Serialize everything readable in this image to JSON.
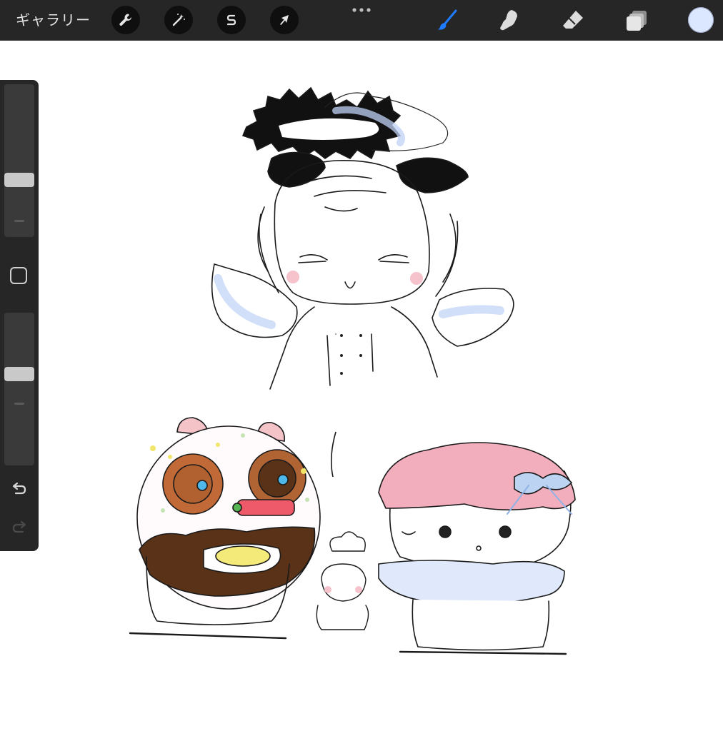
{
  "topbar": {
    "gallery_label": "ギャラリー",
    "actions": [
      {
        "name": "actions",
        "icon": "wrench-icon"
      },
      {
        "name": "adjustments",
        "icon": "magic-wand-icon"
      },
      {
        "name": "selection",
        "icon": "selection-s-icon"
      },
      {
        "name": "transform",
        "icon": "arrow-cursor-icon"
      }
    ],
    "more_icon": "ellipsis-icon",
    "tools": [
      {
        "name": "brush",
        "icon": "brush-icon",
        "active": true
      },
      {
        "name": "smudge",
        "icon": "smudge-finger-icon",
        "active": false
      },
      {
        "name": "eraser",
        "icon": "eraser-icon",
        "active": false
      },
      {
        "name": "layers",
        "icon": "layers-icon",
        "active": false
      }
    ],
    "current_color": "#dbe6ff"
  },
  "sidebar": {
    "brush_size_level": 0.62,
    "opacity_level": 0.62,
    "modify_icon": "square-icon",
    "undo_icon": "undo-icon",
    "redo_icon": "redo-icon"
  },
  "colors": {
    "accent": "#1f7bff",
    "toolbar_bg": "#262626",
    "canvas_bg": "#ffffff"
  }
}
